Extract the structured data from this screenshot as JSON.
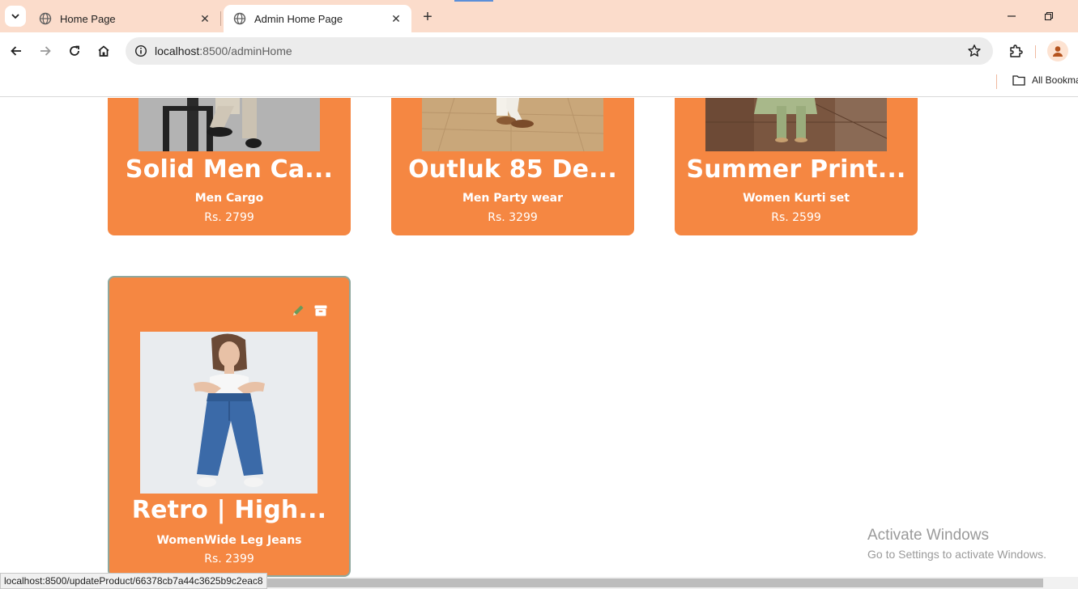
{
  "browser": {
    "tabs": [
      {
        "title": "Home Page",
        "active": false
      },
      {
        "title": "Admin Home Page",
        "active": true
      }
    ],
    "url_host": "localhost",
    "url_path": ":8500/adminHome",
    "bookmarks_label": "All Bookma",
    "status_url": "localhost:8500/updateProduct/66378cb7a44c3625b9c2eac8"
  },
  "products": [
    {
      "title": "Solid Men Ca...",
      "category": "Men Cargo",
      "price": "Rs. 2799"
    },
    {
      "title": "Outluk 85 De...",
      "category": "Men Party wear",
      "price": "Rs. 3299"
    },
    {
      "title": "Summer Print...",
      "category": "Women Kurti set",
      "price": "Rs. 2599"
    },
    {
      "title": "Retro | High...",
      "category": "WomenWide Leg Jeans",
      "price": "Rs. 2399"
    }
  ],
  "watermark": {
    "line1": "Activate Windows",
    "line2": "Go to Settings to activate Windows."
  },
  "colors": {
    "card": "#f58742",
    "tabstrip": "#fbdccb",
    "edit_icon": "#6a9a5a"
  }
}
